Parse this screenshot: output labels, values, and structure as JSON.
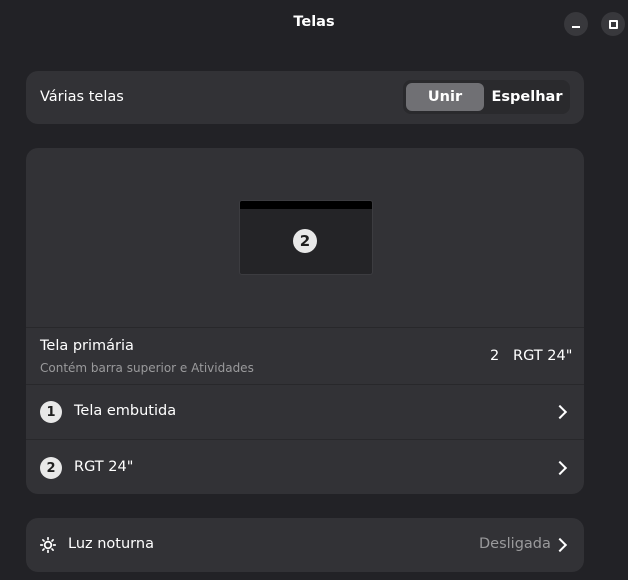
{
  "window": {
    "title": "Telas"
  },
  "multiple_displays": {
    "label": "Várias telas",
    "options": [
      "Unir",
      "Espelhar"
    ],
    "selected": "Unir"
  },
  "arrangement": {
    "monitor_number": "2"
  },
  "primary_display": {
    "label": "Tela primária",
    "sublabel": "Contém barra superior e Atividades",
    "number": "2",
    "name": "RGT 24\""
  },
  "monitors": [
    {
      "number": "1",
      "name": "Tela embutida"
    },
    {
      "number": "2",
      "name": "RGT 24\""
    }
  ],
  "night_light": {
    "label": "Luz noturna",
    "value": "Desligada",
    "icon": "night-light-icon"
  },
  "colors": {
    "window_bg": "#222226",
    "card_bg": "#323236",
    "selected_segment": "#707074",
    "dim_text": "#9a9a9c"
  }
}
